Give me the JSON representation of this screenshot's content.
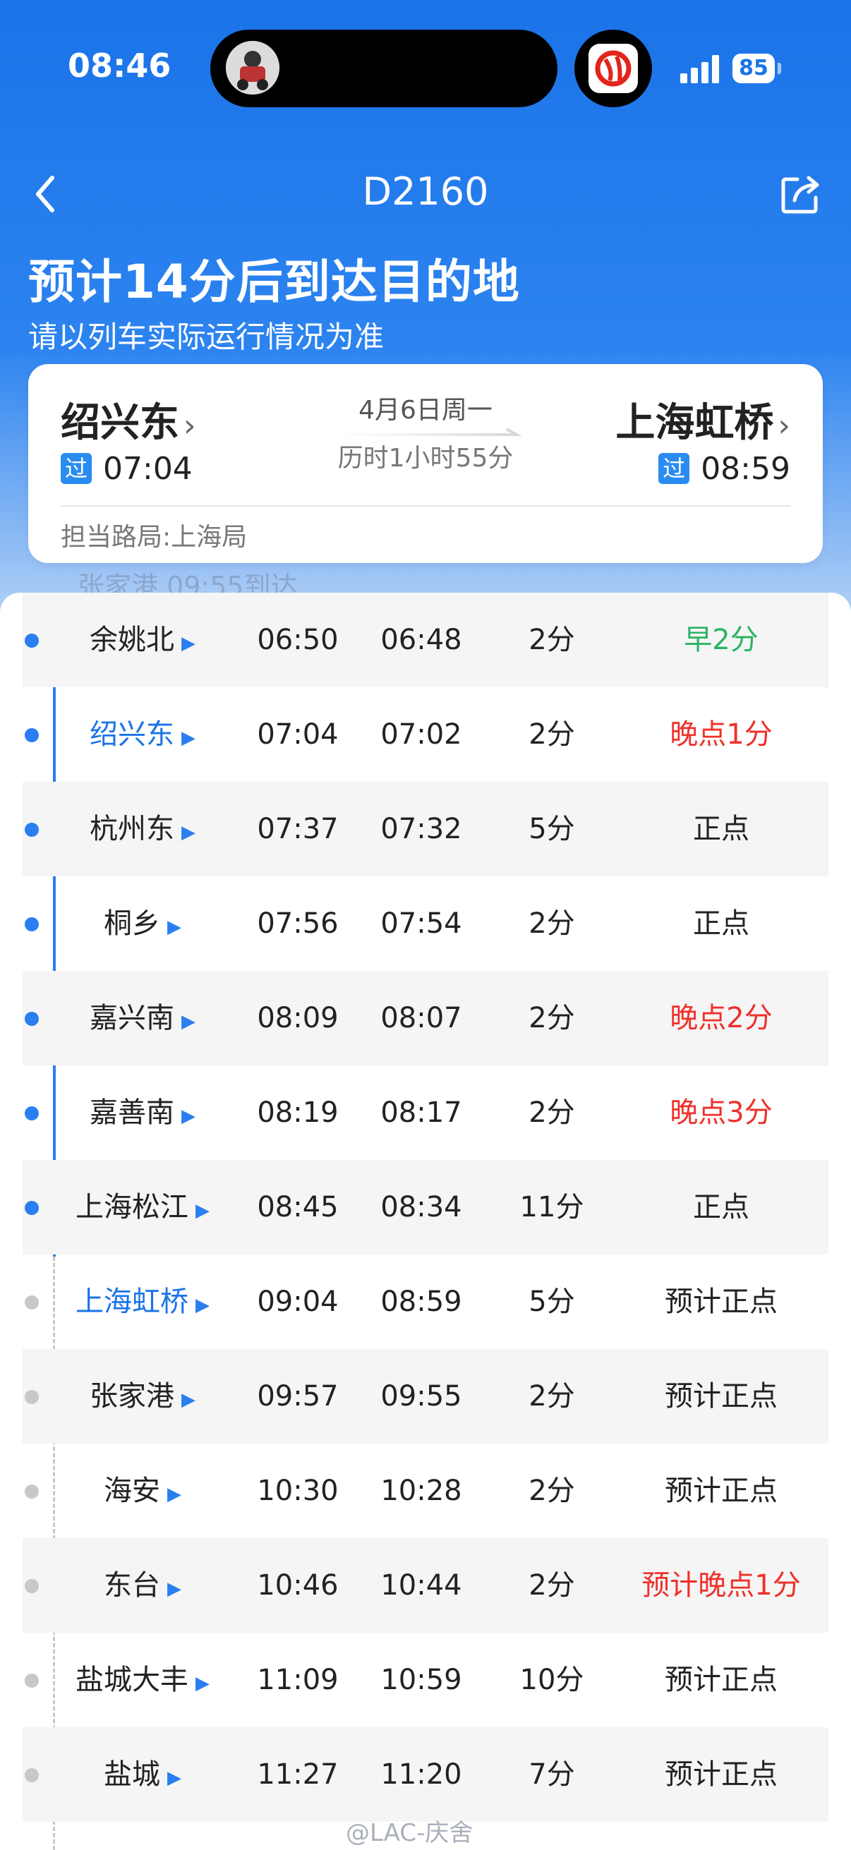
{
  "status_bar": {
    "time": "08:46",
    "battery": "85"
  },
  "nav": {
    "title": "D2160"
  },
  "headline": "预计14分后到达目的地",
  "subline": "请以列车实际运行情况为准",
  "route": {
    "from": {
      "name": "绍兴东",
      "badge": "过",
      "time": "07:04"
    },
    "to": {
      "name": "上海虹桥",
      "badge": "过",
      "time": "08:59"
    },
    "date": "4月6日周一",
    "duration": "历时1小时55分",
    "bureau": "担当路局:上海局",
    "chevron": "›"
  },
  "peek_text": "张家港   09:55到达",
  "colors": {
    "accent": "#1a73e8",
    "early": "#2bb365",
    "late": "#f0302a",
    "normal": "#222222",
    "line_passed": "#2a7ff0",
    "line_future": "#c8c8c8"
  },
  "stops": [
    {
      "name": "余姚北",
      "time1": "06:50",
      "time2": "06:48",
      "stop": "2分",
      "status": "早2分",
      "status_type": "early",
      "passed": true,
      "highlight": false
    },
    {
      "name": "绍兴东",
      "time1": "07:04",
      "time2": "07:02",
      "stop": "2分",
      "status": "晚点1分",
      "status_type": "late",
      "passed": true,
      "highlight": true
    },
    {
      "name": "杭州东",
      "time1": "07:37",
      "time2": "07:32",
      "stop": "5分",
      "status": "正点",
      "status_type": "normal",
      "passed": true,
      "highlight": false
    },
    {
      "name": "桐乡",
      "time1": "07:56",
      "time2": "07:54",
      "stop": "2分",
      "status": "正点",
      "status_type": "normal",
      "passed": true,
      "highlight": false
    },
    {
      "name": "嘉兴南",
      "time1": "08:09",
      "time2": "08:07",
      "stop": "2分",
      "status": "晚点2分",
      "status_type": "late",
      "passed": true,
      "highlight": false
    },
    {
      "name": "嘉善南",
      "time1": "08:19",
      "time2": "08:17",
      "stop": "2分",
      "status": "晚点3分",
      "status_type": "late",
      "passed": true,
      "highlight": false
    },
    {
      "name": "上海松江",
      "time1": "08:45",
      "time2": "08:34",
      "stop": "11分",
      "status": "正点",
      "status_type": "normal",
      "passed": true,
      "highlight": false
    },
    {
      "name": "上海虹桥",
      "time1": "09:04",
      "time2": "08:59",
      "stop": "5分",
      "status": "预计正点",
      "status_type": "normal",
      "passed": false,
      "highlight": true
    },
    {
      "name": "张家港",
      "time1": "09:57",
      "time2": "09:55",
      "stop": "2分",
      "status": "预计正点",
      "status_type": "normal",
      "passed": false,
      "highlight": false
    },
    {
      "name": "海安",
      "time1": "10:30",
      "time2": "10:28",
      "stop": "2分",
      "status": "预计正点",
      "status_type": "normal",
      "passed": false,
      "highlight": false
    },
    {
      "name": "东台",
      "time1": "10:46",
      "time2": "10:44",
      "stop": "2分",
      "status": "预计晚点1分",
      "status_type": "late",
      "passed": false,
      "highlight": false
    },
    {
      "name": "盐城大丰",
      "time1": "11:09",
      "time2": "10:59",
      "stop": "10分",
      "status": "预计正点",
      "status_type": "normal",
      "passed": false,
      "highlight": false
    },
    {
      "name": "盐城",
      "time1": "11:27",
      "time2": "11:20",
      "stop": "7分",
      "status": "预计正点",
      "status_type": "normal",
      "passed": false,
      "highlight": false
    }
  ],
  "watermark": "@LAC-庆舍"
}
